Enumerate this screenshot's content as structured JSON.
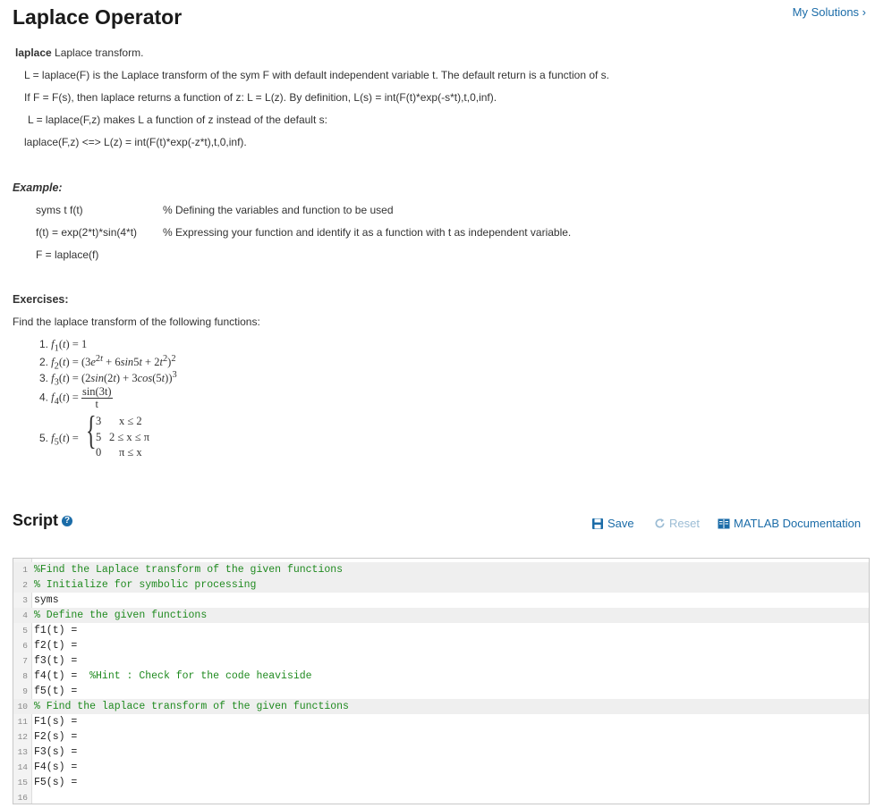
{
  "header": {
    "title": "Laplace Operator",
    "my_solutions": "My Solutions ›"
  },
  "description": {
    "lead_bold": "laplace",
    "lead_rest": " Laplace transform.",
    "line1": "L = laplace(F) is the Laplace transform of the sym F with default independent variable t.  The default return is a function of s.",
    "line2": "If F = F(s), then laplace returns a function of z:  L = L(z).     By definition, L(s) = int(F(t)*exp(-s*t),t,0,inf).",
    "line3": "L = laplace(F,z) makes L a function of z instead of the default s:",
    "line4": "laplace(F,z) <=> L(z) = int(F(t)*exp(-z*t),t,0,inf)."
  },
  "example": {
    "label": "Example:",
    "rows": [
      {
        "code": "syms t f(t)",
        "comment": "% Defining the variables and function to be used"
      },
      {
        "code": "f(t) = exp(2*t)*sin(4*t)",
        "comment": "% Expressing your function and identify it as a function with t as independent variable."
      },
      {
        "code": "F = laplace(f)",
        "comment": ""
      }
    ]
  },
  "exercises": {
    "label": "Exercises:",
    "intro": "Find the laplace transform of the following functions:",
    "numbers": [
      "1.",
      "2.",
      "3.",
      "4.",
      "5."
    ],
    "f4_num": "sin(3t)",
    "f4_den": "t",
    "piece_values": [
      "3",
      "5",
      "0"
    ],
    "piece_conds": [
      "x ≤ 2",
      "2 ≤ x ≤ π",
      "π ≤ x"
    ]
  },
  "script": {
    "title": "Script",
    "save": "Save",
    "reset": "Reset",
    "doc": "MATLAB Documentation",
    "lines": [
      {
        "n": "1",
        "text": "%Find the Laplace transform of the given functions",
        "type": "comment",
        "hl": true
      },
      {
        "n": "2",
        "text": "% Initialize for symbolic processing",
        "type": "comment",
        "hl": true
      },
      {
        "n": "3",
        "text": "syms",
        "type": "code",
        "hl": false
      },
      {
        "n": "4",
        "text": "% Define the given functions",
        "type": "comment",
        "hl": true
      },
      {
        "n": "5",
        "text": "f1(t) =",
        "type": "code",
        "hl": false
      },
      {
        "n": "6",
        "text": "f2(t) =",
        "type": "code",
        "hl": false
      },
      {
        "n": "7",
        "text": "f3(t) =",
        "type": "code",
        "hl": false
      },
      {
        "n": "8",
        "text": "f4(t) =  ",
        "type": "mixed",
        "trail": "%Hint : Check for the code heaviside",
        "hl": false
      },
      {
        "n": "9",
        "text": "f5(t) =",
        "type": "code",
        "hl": false
      },
      {
        "n": "10",
        "text": "% Find the laplace transform of the given functions",
        "type": "comment",
        "hl": true
      },
      {
        "n": "11",
        "text": "F1(s) =",
        "type": "code",
        "hl": false
      },
      {
        "n": "12",
        "text": "F2(s) =",
        "type": "code",
        "hl": false
      },
      {
        "n": "13",
        "text": "F3(s) =",
        "type": "code",
        "hl": false
      },
      {
        "n": "14",
        "text": "F4(s) =",
        "type": "code",
        "hl": false
      },
      {
        "n": "15",
        "text": "F5(s) =",
        "type": "code",
        "hl": false
      },
      {
        "n": "16",
        "text": "",
        "type": "code",
        "hl": false
      }
    ]
  }
}
